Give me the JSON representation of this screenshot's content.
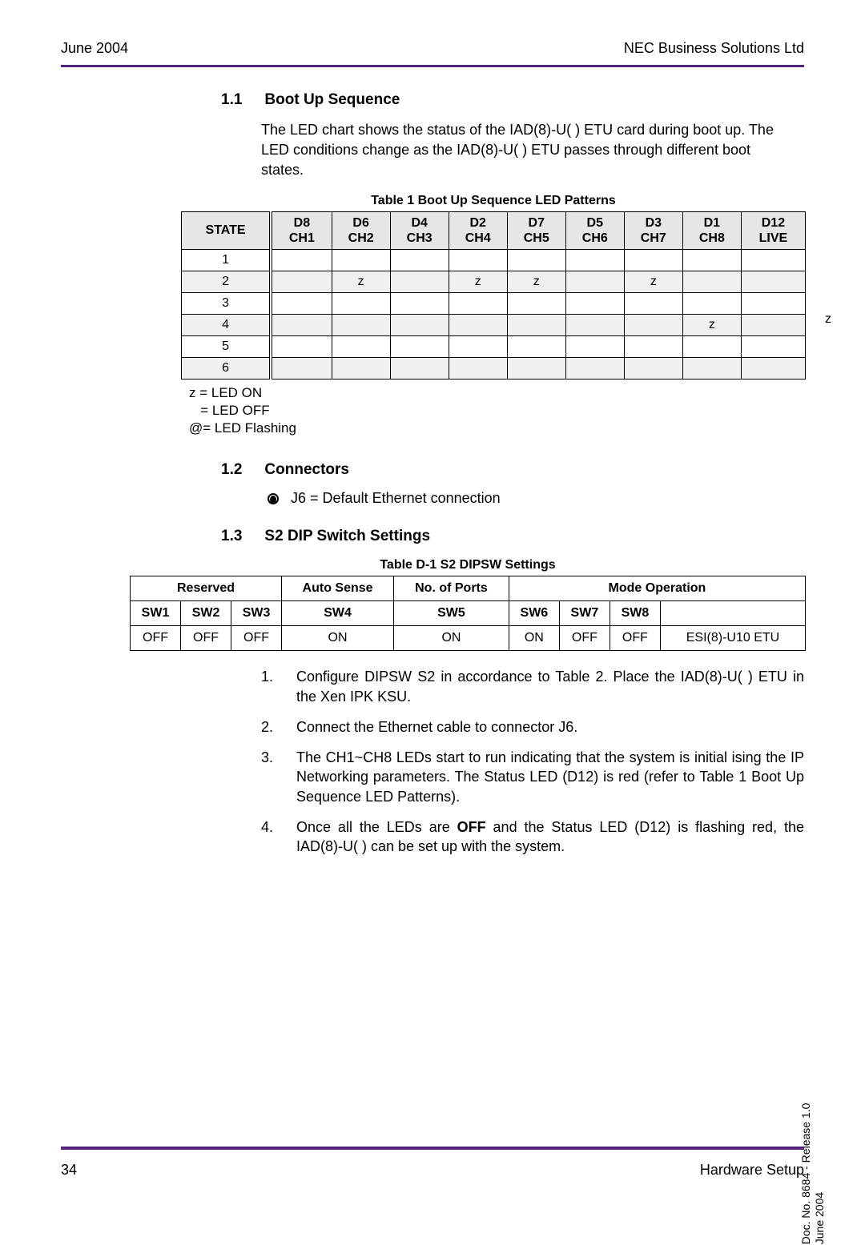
{
  "header": {
    "left": "June 2004",
    "right": "NEC Business Solutions Ltd"
  },
  "s11": {
    "num": "1.1",
    "title": "Boot Up Sequence",
    "para": "The LED chart shows the status of the IAD(8)-U( ) ETU card during boot up. The LED conditions change as the IAD(8)-U( ) ETU passes through different boot states."
  },
  "table1": {
    "caption": "Table 1   Boot Up Sequence LED Patterns",
    "headers": {
      "state": "STATE",
      "c1a": "D8",
      "c1b": "CH1",
      "c2a": "D6",
      "c2b": "CH2",
      "c3a": "D4",
      "c3b": "CH3",
      "c4a": "D2",
      "c4b": "CH4",
      "c5a": "D7",
      "c5b": "CH5",
      "c6a": "D5",
      "c6b": "CH6",
      "c7a": "D3",
      "c7b": "CH7",
      "c8a": "D1",
      "c8b": "CH8",
      "c9a": "D12",
      "c9b": "LIVE"
    },
    "rows": [
      {
        "state": "1",
        "c1": "",
        "c2": "",
        "c3": "",
        "c4": "",
        "c5": "",
        "c6": "",
        "c7": "",
        "c8": "",
        "c9": ""
      },
      {
        "state": "2",
        "c1": "",
        "c2": "z",
        "c3": "",
        "c4": "z",
        "c5": "z",
        "c6": "",
        "c7": "z",
        "c8": "",
        "c9": ""
      },
      {
        "state": "3",
        "c1": "",
        "c2": "",
        "c3": "",
        "c4": "",
        "c5": "",
        "c6": "",
        "c7": "",
        "c8": "",
        "c9": ""
      },
      {
        "state": "4",
        "c1": "",
        "c2": "",
        "c3": "",
        "c4": "",
        "c5": "",
        "c6": "",
        "c7": "",
        "c8": "z",
        "c9": ""
      },
      {
        "state": "5",
        "c1": "",
        "c2": "",
        "c3": "",
        "c4": "",
        "c5": "",
        "c6": "",
        "c7": "",
        "c8": "",
        "c9": ""
      },
      {
        "state": "6",
        "c1": "",
        "c2": "",
        "c3": "",
        "c4": "",
        "c5": "",
        "c6": "",
        "c7": "",
        "c8": "",
        "c9": ""
      }
    ]
  },
  "legend": {
    "l1": "z = LED ON",
    "l2": "   = LED OFF",
    "l3": "@= LED Flashing"
  },
  "stray_z": "z",
  "s12": {
    "num": "1.2",
    "title": "Connectors",
    "item": "J6 = Default Ethernet connection"
  },
  "s13": {
    "num": "1.3",
    "title": "S2 DIP Switch Settings"
  },
  "table2": {
    "caption": "Table D-1    S2 DIPSW Settings",
    "h": {
      "reserved": "Reserved",
      "auto": "Auto Sense",
      "ports": "No. of Ports",
      "mode": "Mode Operation",
      "sw1": "SW1",
      "sw2": "SW2",
      "sw3": "SW3",
      "sw4": "SW4",
      "sw5": "SW5",
      "sw6": "SW6",
      "sw7": "SW7",
      "sw8": "SW8"
    },
    "row": {
      "sw1": "OFF",
      "sw2": "OFF",
      "sw3": "OFF",
      "sw4": "ON",
      "sw5": "ON",
      "sw6": "ON",
      "sw7": "OFF",
      "sw8": "OFF",
      "mode": "ESI(8)-U10 ETU"
    }
  },
  "olist": {
    "n1": "1.",
    "t1": "Configure DIPSW S2 in accordance to Table 2. Place the IAD(8)-U( ) ETU in the Xen IPK KSU.",
    "n2": "2.",
    "t2": "Connect the Ethernet cable to connector J6.",
    "n3": "3.",
    "t3": "The CH1~CH8 LEDs start to run indicating that the system is initial ising the IP Networking parameters.  The Status LED (D12) is red (refer to Table 1 Boot Up Sequence LED Patterns).",
    "n4": "4.",
    "t4a": "Once all the LEDs are ",
    "t4b": "OFF",
    "t4c": " and the Status LED (D12) is flashing red, the IAD(8)-U( ) can be set up with the system."
  },
  "side": {
    "l1": "Doc. No. 8684 - Release 1.0",
    "l2": "June 2004"
  },
  "footer": {
    "left": "34",
    "right": "Hardware Setup"
  }
}
